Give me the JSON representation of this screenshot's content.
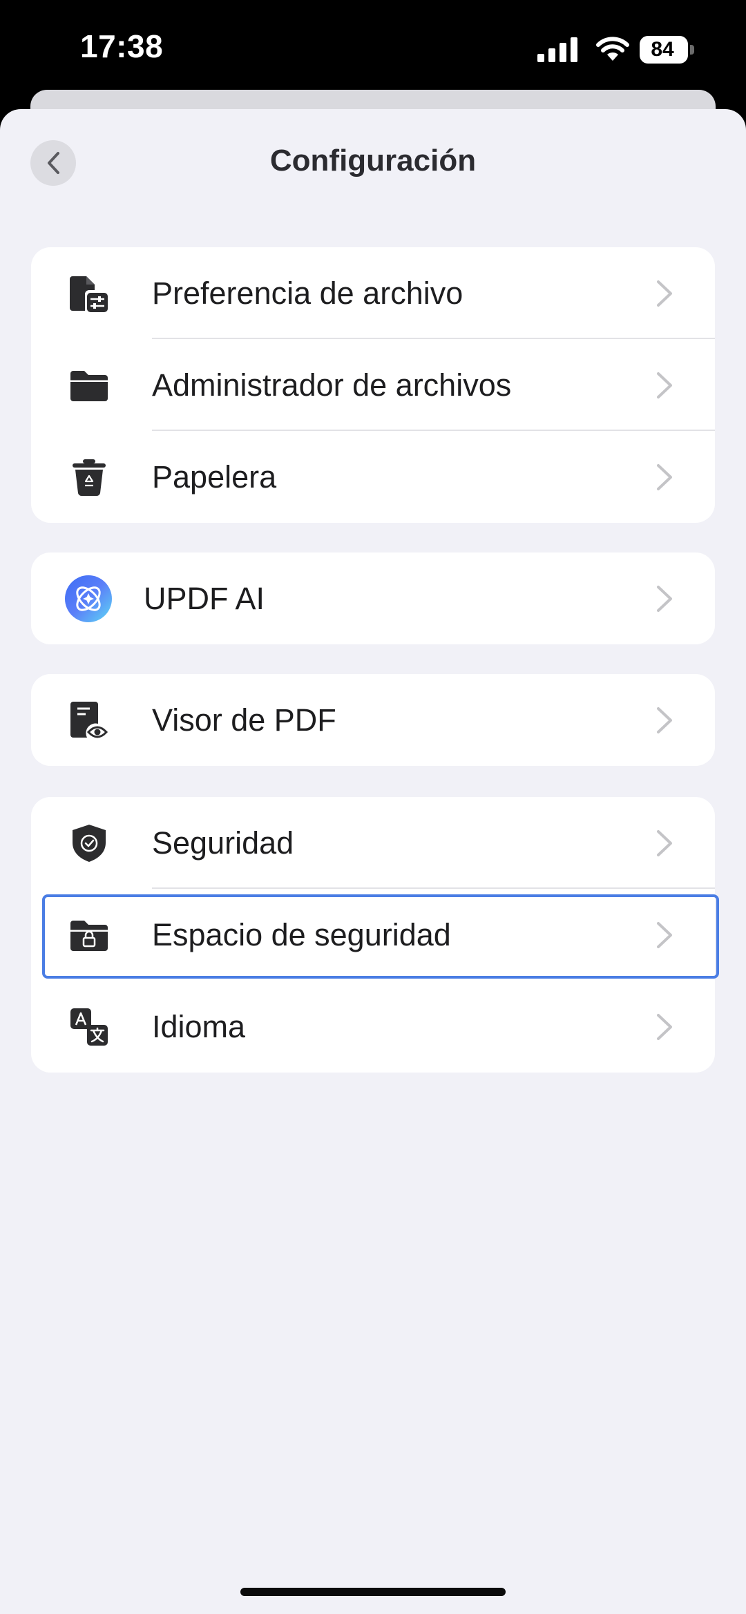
{
  "status_bar": {
    "time": "17:38",
    "battery": "84"
  },
  "header": {
    "title": "Configuración",
    "back_icon": "chevron-left-icon"
  },
  "groups": [
    {
      "items": [
        {
          "label": "Preferencia de archivo",
          "icon": "file-settings-icon"
        },
        {
          "label": "Administrador de archivos",
          "icon": "folder-icon"
        },
        {
          "label": "Papelera",
          "icon": "trash-icon"
        }
      ]
    },
    {
      "items": [
        {
          "label": "UPDF AI",
          "icon": "updf-ai-icon"
        }
      ]
    },
    {
      "items": [
        {
          "label": "Visor de PDF",
          "icon": "pdf-viewer-icon"
        }
      ]
    },
    {
      "items": [
        {
          "label": "Seguridad",
          "icon": "shield-check-icon"
        },
        {
          "label": "Espacio de seguridad",
          "icon": "lock-folder-icon",
          "selected": true
        },
        {
          "label": "Idioma",
          "icon": "translate-icon"
        }
      ]
    }
  ],
  "colors": {
    "background": "#f1f1f7",
    "card": "#ffffff",
    "selection_border": "#4a7de4",
    "icon": "#2c2c2e",
    "chevron": "#c4c4c7"
  }
}
